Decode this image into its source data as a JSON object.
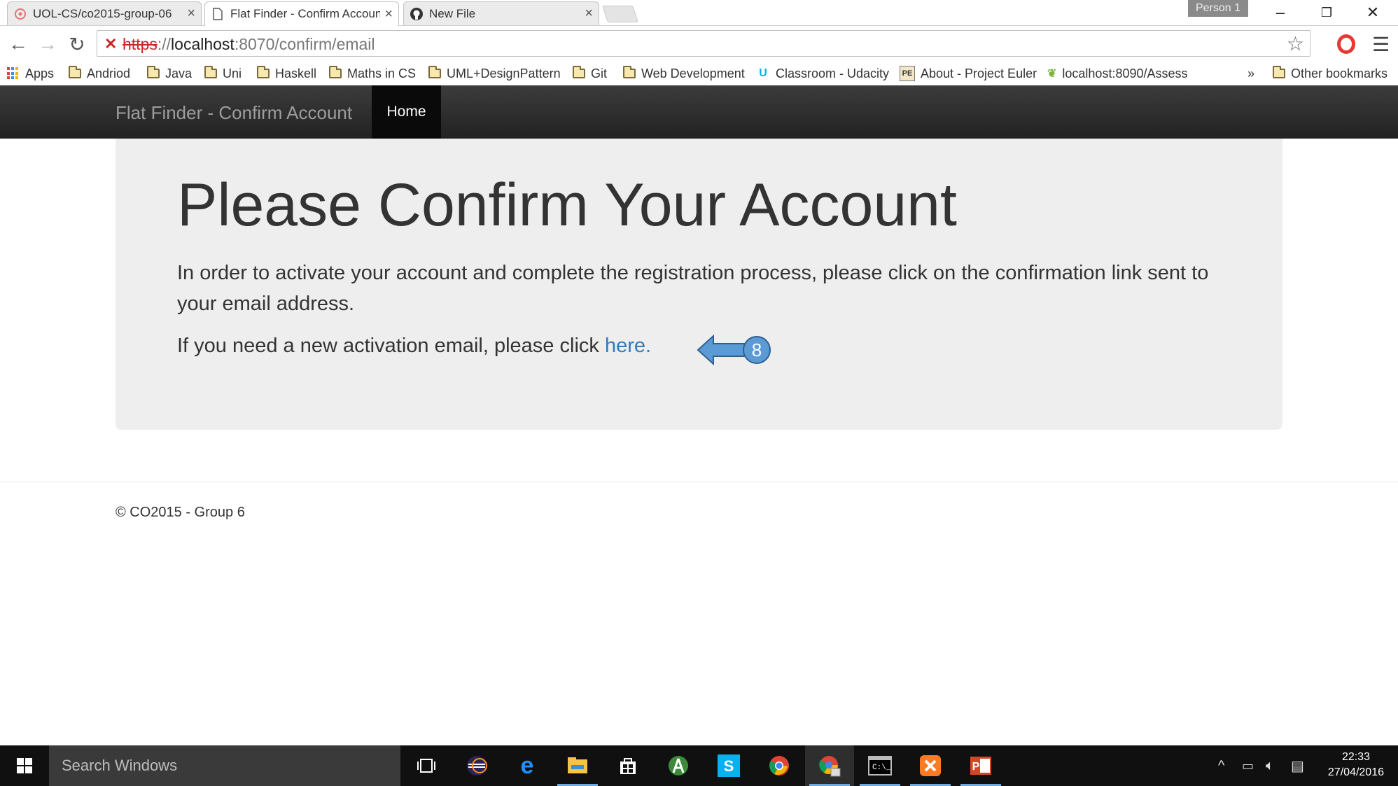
{
  "browser": {
    "tabs": [
      {
        "title": "UOL-CS/co2015-group-06",
        "icon": "github-repo-icon"
      },
      {
        "title": "Flat Finder - Confirm Account",
        "icon": "page-icon",
        "active": true
      },
      {
        "title": "New File",
        "icon": "github-icon"
      }
    ],
    "profile": "Person 1",
    "url": {
      "scheme": "https",
      "rest": "://",
      "host": "localhost",
      "path": ":8070/confirm/email"
    },
    "bookmarks": [
      {
        "label": "Apps",
        "icon": "apps-grid-icon"
      },
      {
        "label": "Andriod",
        "icon": "folder-icon"
      },
      {
        "label": "Java",
        "icon": "folder-icon"
      },
      {
        "label": "Uni",
        "icon": "folder-icon"
      },
      {
        "label": "Haskell",
        "icon": "folder-icon"
      },
      {
        "label": "Maths in CS",
        "icon": "folder-icon"
      },
      {
        "label": "UML+DesignPattern",
        "icon": "folder-icon"
      },
      {
        "label": "Git",
        "icon": "folder-icon"
      },
      {
        "label": "Web Development",
        "icon": "folder-icon"
      },
      {
        "label": "Classroom - Udacity",
        "icon": "udacity-icon"
      },
      {
        "label": "About - Project Euler",
        "icon": "project-euler-icon"
      },
      {
        "label": "localhost:8090/Assess",
        "icon": "leaf-icon"
      }
    ],
    "overflow": "»",
    "other_bookmarks": "Other bookmarks"
  },
  "site": {
    "brand": "Flat Finder - Confirm Account",
    "nav_home": "Home",
    "jumbotron": {
      "title": "Please Confirm Your Account",
      "text": "In order to activate your account and complete the registration process, please click on the confirmation link sent to your email address.",
      "activation_prefix": "If you need a new activation email, please click ",
      "activation_link": "here.",
      "annotation_number": "8"
    },
    "footer": "© CO2015 - Group 6"
  },
  "taskbar": {
    "search_placeholder": "Search Windows",
    "time": "22:33",
    "date": "27/04/2016"
  },
  "colors": {
    "navbar": "#222222",
    "jumbotron_bg": "#eeeeee",
    "link": "#337ab7",
    "annotation_arrow": "#5b9bd5"
  }
}
